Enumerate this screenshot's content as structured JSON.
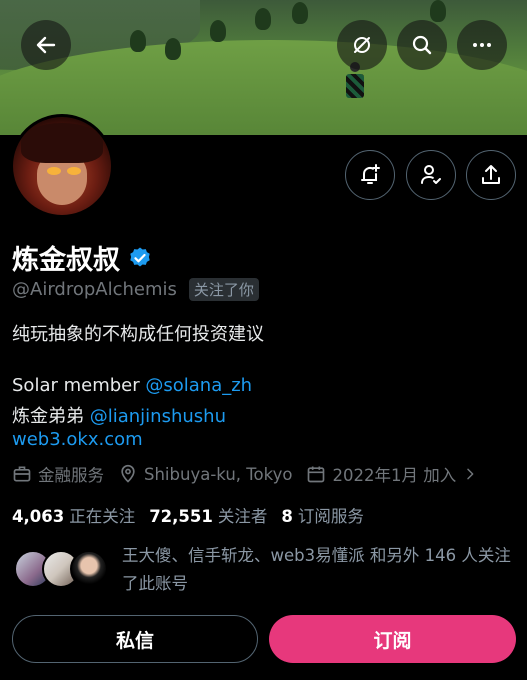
{
  "profile": {
    "name": "炼金叔叔",
    "handle": "@AirdropAlchemis",
    "follows_you_badge": "关注了你",
    "bio_line1": "纯玩抽象的不构成任何投资建议",
    "bio_solana_prefix": "Solar member ",
    "bio_solana_link": "@solana_zh",
    "bio_brother_prefix": "炼金弟弟 ",
    "bio_brother_link": "@lianjinshushu",
    "website": "web3.okx.com"
  },
  "meta": {
    "category": "金融服务",
    "location": "Shibuya-ku, Tokyo",
    "joined": "2022年1月 加入"
  },
  "stats": {
    "following_count": "4,063",
    "following_label": "正在关注",
    "followers_count": "72,551",
    "followers_label": "关注者",
    "subscriptions_count": "8",
    "subscriptions_label": "订阅服务"
  },
  "followed_by": {
    "text": "王大傻、信手斩龙、web3易懂派 和另外 146 人关注了此账号"
  },
  "actions": {
    "dm_label": "私信",
    "subscribe_label": "订阅"
  },
  "icons": {
    "back": "back-arrow-icon",
    "grok": "grok-icon",
    "search": "search-icon",
    "more": "more-icon",
    "notify": "bell-plus-icon",
    "follow": "person-check-icon",
    "share": "share-icon",
    "verified": "verified-badge-icon",
    "category": "briefcase-icon",
    "location": "location-pin-icon",
    "joined": "calendar-icon"
  },
  "colors": {
    "accent_link": "#1d9bf0",
    "subscribe_button": "#e7387c",
    "verified": "#1d9bf0"
  }
}
